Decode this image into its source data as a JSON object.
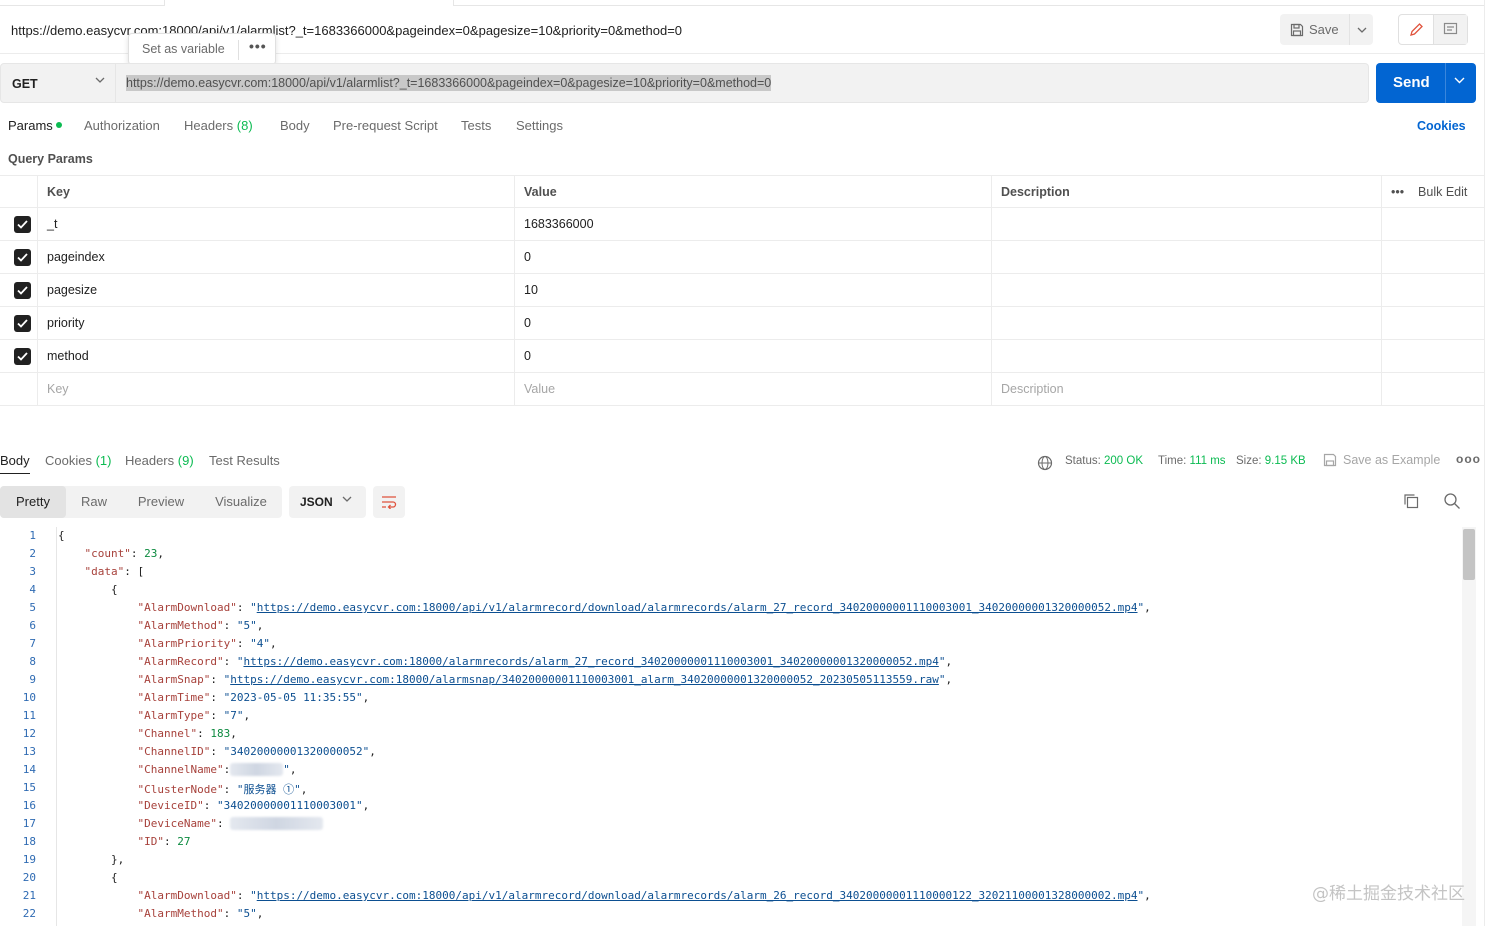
{
  "title_url": "https://demo.easycvr.com:18000/api/v1/alarmlist?_t=1683366000&pageindex=0&pagesize=10&priority=0&method=0",
  "popup": {
    "label": "Set as variable",
    "more": "•••"
  },
  "toolbar": {
    "save_label": "Save"
  },
  "request": {
    "method": "GET",
    "url": "https://demo.easycvr.com:18000/api/v1/alarmlist?_t=1683366000&pageindex=0&pagesize=10&priority=0&method=0",
    "send_label": "Send"
  },
  "req_tabs": {
    "params": "Params",
    "authorization": "Authorization",
    "headers": "Headers",
    "headers_count": "(8)",
    "body": "Body",
    "prerequest": "Pre-request Script",
    "tests": "Tests",
    "settings": "Settings",
    "cookies": "Cookies"
  },
  "query_params": {
    "title": "Query Params",
    "columns": {
      "key": "Key",
      "value": "Value",
      "description": "Description",
      "bulk_more": "•••",
      "bulk_edit": "Bulk Edit"
    },
    "rows": [
      {
        "key": "_t",
        "value": "1683366000",
        "checked": true
      },
      {
        "key": "pageindex",
        "value": "0",
        "checked": true
      },
      {
        "key": "pagesize",
        "value": "10",
        "checked": true
      },
      {
        "key": "priority",
        "value": "0",
        "checked": true
      },
      {
        "key": "method",
        "value": "0",
        "checked": true
      }
    ],
    "placeholders": {
      "key": "Key",
      "value": "Value",
      "description": "Description"
    }
  },
  "resp_tabs": {
    "body": "Body",
    "cookies": "Cookies",
    "cookies_count": "(1)",
    "headers": "Headers",
    "headers_count": "(9)",
    "test_results": "Test Results"
  },
  "resp_meta": {
    "status_label": "Status:",
    "status_value": "200 OK",
    "time_label": "Time:",
    "time_value": "111 ms",
    "size_label": "Size:",
    "size_value": "9.15 KB",
    "save_example": "Save as Example",
    "more": "ooo"
  },
  "view_tabs": {
    "pretty": "Pretty",
    "raw": "Raw",
    "preview": "Preview",
    "visualize": "Visualize",
    "format": "JSON"
  },
  "code_lines": [
    {
      "n": "1"
    },
    {
      "n": "2"
    },
    {
      "n": "3"
    },
    {
      "n": "4"
    },
    {
      "n": "5"
    },
    {
      "n": "6"
    },
    {
      "n": "7"
    },
    {
      "n": "8"
    },
    {
      "n": "9"
    },
    {
      "n": "10"
    },
    {
      "n": "11"
    },
    {
      "n": "12"
    },
    {
      "n": "13"
    },
    {
      "n": "14"
    },
    {
      "n": "15"
    },
    {
      "n": "16"
    },
    {
      "n": "17"
    },
    {
      "n": "18"
    },
    {
      "n": "19"
    },
    {
      "n": "20"
    },
    {
      "n": "21"
    },
    {
      "n": "22"
    }
  ],
  "json": {
    "count_key": "\"count\"",
    "count_val": "23",
    "data_key": "\"data\"",
    "alarm_download_key": "\"AlarmDownload\"",
    "alarm_download_val": "https://demo.easycvr.com:18000/api/v1/alarmrecord/download/alarmrecords/alarm_27_record_34020000001110003001_34020000001320000052.mp4",
    "alarm_method_key": "\"AlarmMethod\"",
    "alarm_method_val": "\"5\"",
    "alarm_priority_key": "\"AlarmPriority\"",
    "alarm_priority_val": "\"4\"",
    "alarm_record_key": "\"AlarmRecord\"",
    "alarm_record_val": "https://demo.easycvr.com:18000/alarmrecords/alarm_27_record_34020000001110003001_34020000001320000052.mp4",
    "alarm_snap_key": "\"AlarmSnap\"",
    "alarm_snap_val": "https://demo.easycvr.com:18000/alarmsnap/34020000001110003001_alarm_34020000001320000052_20230505113559.raw",
    "alarm_time_key": "\"AlarmTime\"",
    "alarm_time_val": "\"2023-05-05 11:35:55\"",
    "alarm_type_key": "\"AlarmType\"",
    "alarm_type_val": "\"7\"",
    "channel_key": "\"Channel\"",
    "channel_val": "183",
    "channel_id_key": "\"ChannelID\"",
    "channel_id_val": "\"34020000001320000052\"",
    "channel_name_key": "\"ChannelName\"",
    "cluster_node_key": "\"ClusterNode\"",
    "cluster_node_val": "\"服务器 ①\"",
    "device_id_key": "\"DeviceID\"",
    "device_id_val": "\"34020000001110003001\"",
    "device_name_key": "\"DeviceName\"",
    "id_key": "\"ID\"",
    "id_val": "27",
    "alarm_download_val_2": "https://demo.easycvr.com:18000/api/v1/alarmrecord/download/alarmrecords/alarm_26_record_34020000001110000122_32021100001328000002.mp4",
    "alarm_method_val_2": "\"5\""
  },
  "watermark": "@稀土掘金技术社区",
  "colors": {
    "accent": "#0265d2",
    "green": "#0cbb52",
    "json_key": "#a7413b",
    "json_string": "#0c4f91",
    "json_number": "#0c8a3f"
  }
}
